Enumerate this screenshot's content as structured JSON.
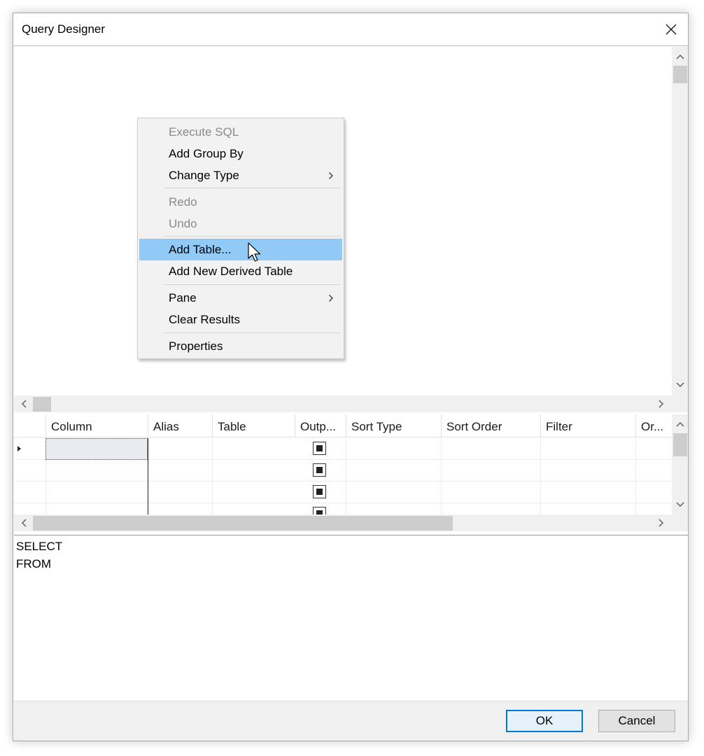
{
  "window": {
    "title": "Query Designer"
  },
  "context_menu": {
    "items": [
      {
        "label": "Execute SQL",
        "disabled": true
      },
      {
        "label": "Add Group By",
        "disabled": false
      },
      {
        "label": "Change Type",
        "disabled": false,
        "submenu": true
      },
      {
        "label": "Redo",
        "disabled": true
      },
      {
        "label": "Undo",
        "disabled": true
      },
      {
        "label": "Add Table...",
        "disabled": false,
        "highlighted": true
      },
      {
        "label": "Add New Derived Table",
        "disabled": false
      },
      {
        "label": "Pane",
        "disabled": false,
        "submenu": true
      },
      {
        "label": "Clear Results",
        "disabled": false
      },
      {
        "label": "Properties",
        "disabled": false
      }
    ],
    "highlight_color": "#91c9f7"
  },
  "grid": {
    "columns": [
      "Column",
      "Alias",
      "Table",
      "Outp...",
      "Sort Type",
      "Sort Order",
      "Filter",
      "Or..."
    ]
  },
  "sql": {
    "lines": [
      "SELECT",
      "FROM"
    ]
  },
  "buttons": {
    "ok": "OK",
    "cancel": "Cancel"
  },
  "colors": {
    "accent": "#0078d7"
  }
}
